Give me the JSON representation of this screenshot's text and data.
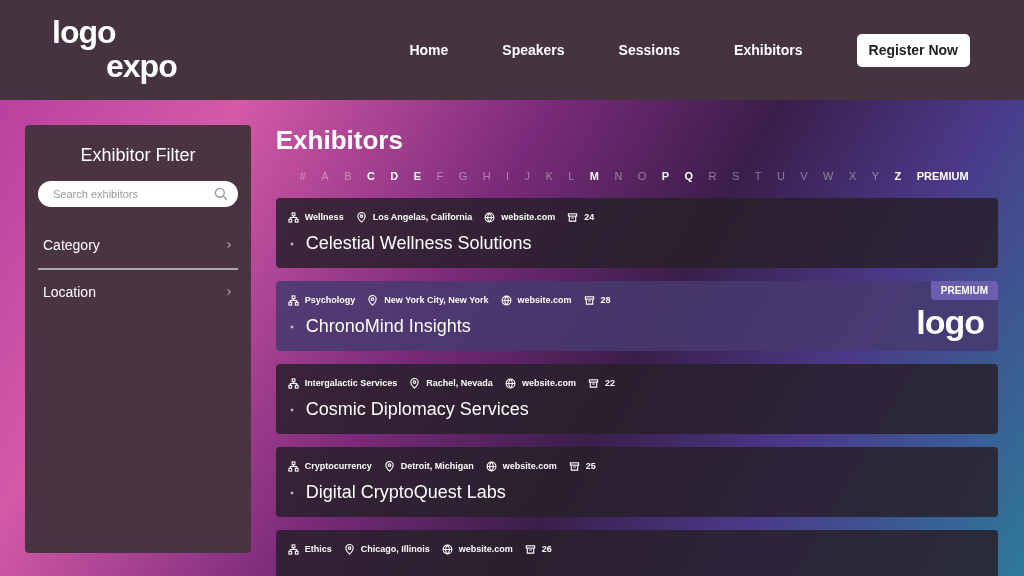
{
  "header": {
    "logo": [
      "logo",
      "expo"
    ],
    "nav": [
      "Home",
      "Speakers",
      "Sessions",
      "Exhibitors"
    ],
    "cta": "Register Now"
  },
  "filter": {
    "title": "Exhibitor Filter",
    "search": {
      "placeholder": "Search exhibitors"
    },
    "groups": [
      "Category",
      "Location"
    ]
  },
  "page_title": "Exhibitors",
  "letters": [
    {
      "label": "#",
      "enabled": false
    },
    {
      "label": "A",
      "enabled": false
    },
    {
      "label": "B",
      "enabled": false
    },
    {
      "label": "C",
      "enabled": true
    },
    {
      "label": "D",
      "enabled": true
    },
    {
      "label": "E",
      "enabled": true
    },
    {
      "label": "F",
      "enabled": false
    },
    {
      "label": "G",
      "enabled": false
    },
    {
      "label": "H",
      "enabled": false
    },
    {
      "label": "I",
      "enabled": false
    },
    {
      "label": "J",
      "enabled": false
    },
    {
      "label": "K",
      "enabled": false
    },
    {
      "label": "L",
      "enabled": false
    },
    {
      "label": "M",
      "enabled": true
    },
    {
      "label": "N",
      "enabled": false
    },
    {
      "label": "O",
      "enabled": false
    },
    {
      "label": "P",
      "enabled": true
    },
    {
      "label": "Q",
      "enabled": true
    },
    {
      "label": "R",
      "enabled": false
    },
    {
      "label": "S",
      "enabled": false
    },
    {
      "label": "T",
      "enabled": false
    },
    {
      "label": "U",
      "enabled": false
    },
    {
      "label": "V",
      "enabled": false
    },
    {
      "label": "W",
      "enabled": false
    },
    {
      "label": "X",
      "enabled": false
    },
    {
      "label": "Y",
      "enabled": false
    },
    {
      "label": "Z",
      "enabled": true
    },
    {
      "label": "PREMIUM",
      "enabled": true
    }
  ],
  "exhibitors": [
    {
      "category": "Wellness",
      "location": "Los Angelas, California",
      "website": "website.com",
      "count": "24",
      "name": "Celestial Wellness Solutions",
      "premium": false
    },
    {
      "category": "Psychology",
      "location": "New York City, New York",
      "website": "website.com",
      "count": "28",
      "name": "ChronoMind Insights",
      "premium": true,
      "badge": "PREMIUM",
      "logo": "logo"
    },
    {
      "category": "Intergalactic Services",
      "location": "Rachel, Nevada",
      "website": "website.com",
      "count": "22",
      "name": "Cosmic Diplomacy Services",
      "premium": false
    },
    {
      "category": "Cryptocurrency",
      "location": "Detroit, Michigan",
      "website": "website.com",
      "count": "25",
      "name": "Digital CryptoQuest Labs",
      "premium": false
    },
    {
      "category": "Ethics",
      "location": "Chicago, Illinois",
      "website": "website.com",
      "count": "26",
      "premium": false
    }
  ]
}
